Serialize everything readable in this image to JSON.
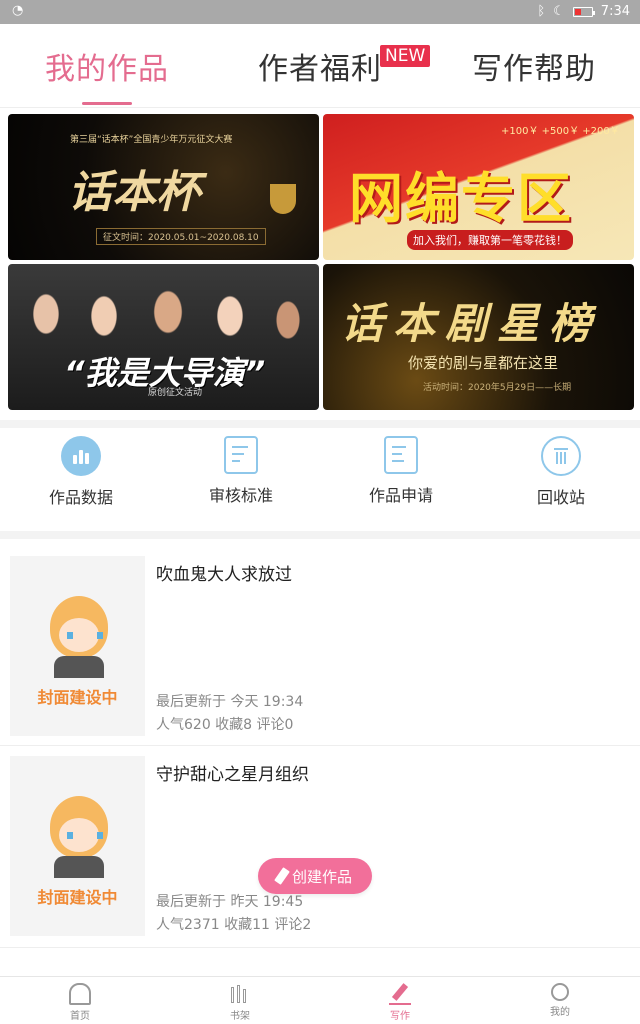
{
  "status_bar": {
    "time": "7:34"
  },
  "tabs": [
    {
      "label": "我的作品",
      "active": true
    },
    {
      "label": "作者福利",
      "badge": "NEW"
    },
    {
      "label": "写作帮助"
    }
  ],
  "banners": [
    {
      "subtitle": "第三届“话本杯”全国青少年万元征文大赛",
      "title": "话本杯",
      "date": "征文时间：2020.05.01~2020.08.10"
    },
    {
      "money": "+100￥ +500￥ +200￥",
      "title": "网编专区",
      "tagline": "加入我们，赚取第一笔零花钱！"
    },
    {
      "title": "“我是大导演”",
      "subtitle": "原创征文活动"
    },
    {
      "title": "话本剧星榜",
      "subtitle": "你爱的剧与星都在这里",
      "date": "活动时间：2020年5月29日——长期"
    }
  ],
  "shortcuts": [
    {
      "label": "作品数据",
      "icon": "bar-chart-icon"
    },
    {
      "label": "审核标准",
      "icon": "review-doc-icon"
    },
    {
      "label": "作品申请",
      "icon": "edit-doc-icon"
    },
    {
      "label": "回收站",
      "icon": "trash-icon"
    }
  ],
  "works": [
    {
      "cover_text": "封面建设中",
      "title": "吹血鬼大人求放过",
      "updated": "最后更新于 今天 19:34",
      "stats": "人气620 收藏8 评论0"
    },
    {
      "cover_text": "封面建设中",
      "title": "守护甜心之星月组织",
      "updated": "最后更新于 昨天 19:45",
      "stats": "人气2371 收藏11 评论2"
    }
  ],
  "fab": {
    "label": "创建作品"
  },
  "bottom_nav": [
    {
      "label": "首页",
      "icon": "home-icon"
    },
    {
      "label": "书架",
      "icon": "bookshelf-icon"
    },
    {
      "label": "写作",
      "icon": "pen-icon",
      "active": true
    },
    {
      "label": "我的",
      "icon": "profile-icon"
    }
  ],
  "colors": {
    "accent": "#e46c8f",
    "badge": "#e8304c",
    "icon": "#8ec7ea",
    "fab": "#f26f9a"
  }
}
